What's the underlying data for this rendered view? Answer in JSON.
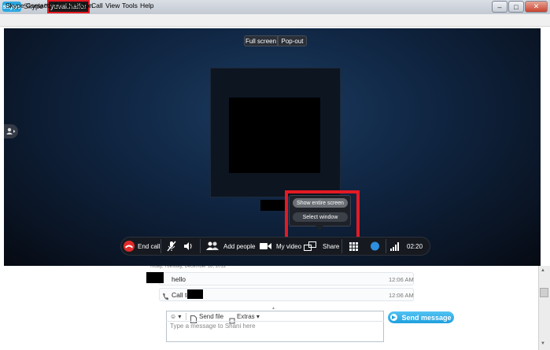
{
  "window": {
    "logo_text": "skype",
    "app_title": "Skype™",
    "user_name": "yuval.haifor",
    "minimize": "–",
    "maximize": "□",
    "close": "✕"
  },
  "menu": [
    "Skype",
    "Contacts",
    "Conversation",
    "Call",
    "View",
    "Tools",
    "Help"
  ],
  "video": {
    "full_screen_label": "Full screen",
    "popout_label": "Pop-out"
  },
  "share_popup": {
    "show_entire_screen": "Show entire screen",
    "select_window": "Select window"
  },
  "call_controls": {
    "end_call": "End call",
    "add_people": "Add people",
    "my_video": "My video",
    "share": "Share",
    "timer": "02:20"
  },
  "conversation": {
    "date_line": "Today, Tuesday, December 18, 2012",
    "messages": [
      {
        "text": "hello",
        "time": "12:06 AM"
      },
      {
        "text": "Call to",
        "time": "12:06 AM"
      }
    ]
  },
  "composer": {
    "emoticon": "☺ ▾",
    "send_file": "Send file",
    "extras": "Extras ▾",
    "placeholder": "Type a message to Shani here",
    "send_button": "Send message"
  },
  "colors": {
    "accent": "#1f9fde",
    "highlight_red": "#e51a23",
    "end_call_red": "#e02b2b"
  }
}
